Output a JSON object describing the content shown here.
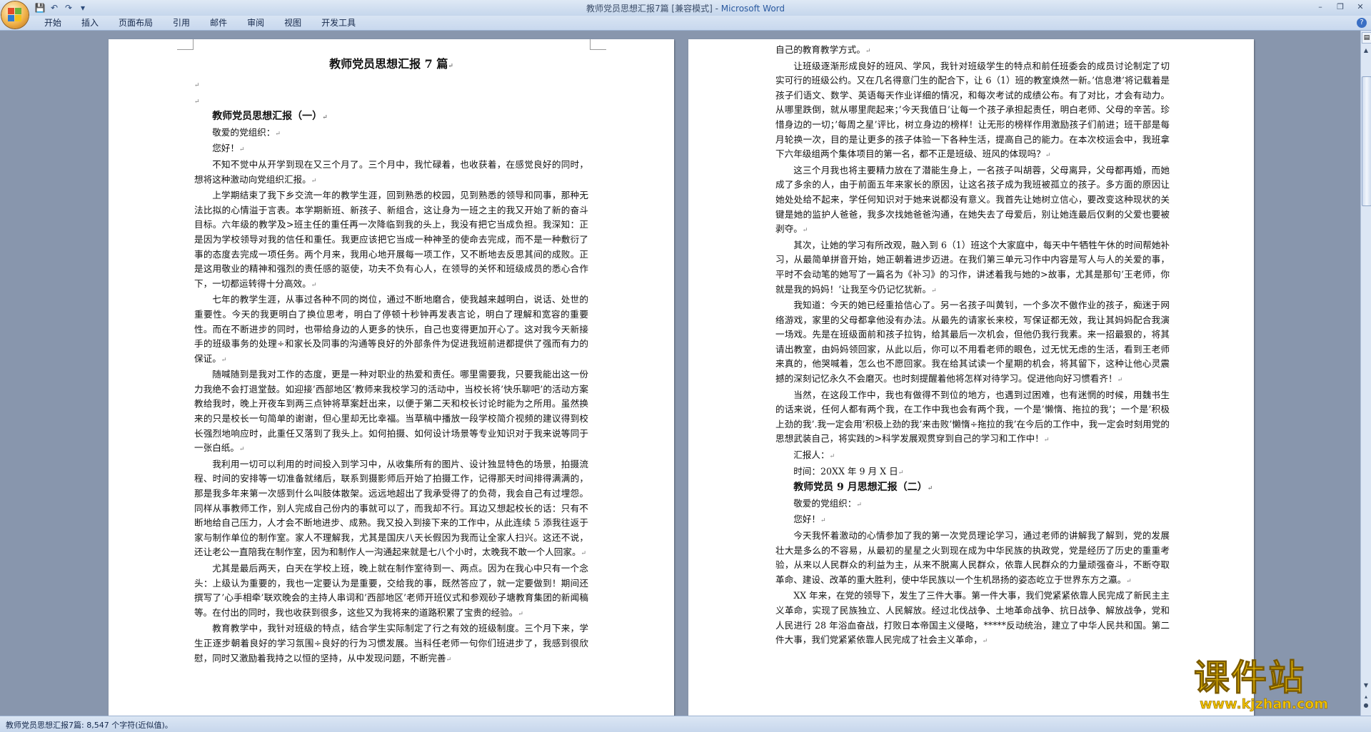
{
  "window": {
    "title": "教师党员思想汇报7篇 [兼容模式]",
    "app": "Microsoft Word"
  },
  "ribbon": {
    "tabs": [
      "开始",
      "插入",
      "页面布局",
      "引用",
      "邮件",
      "审阅",
      "视图",
      "开发工具"
    ]
  },
  "document": {
    "page1": [
      {
        "t": "doctitle",
        "x": "教师党员思想汇报 7 篇"
      },
      {
        "t": "ni",
        "x": ""
      },
      {
        "t": "ni",
        "x": ""
      },
      {
        "t": "h",
        "x": "教师党员思想汇报（一）"
      },
      {
        "t": "p",
        "x": "敬爱的党组织："
      },
      {
        "t": "p",
        "x": "您好！"
      },
      {
        "t": "p",
        "x": "不知不觉中从开学到现在又三个月了。三个月中，我忙碌着，也收获着，在感觉良好的同时，想将这种激动向党组织汇报。"
      },
      {
        "t": "p",
        "x": "上学期结束了我下乡交流一年的教学生涯，回到熟悉的校园，见到熟悉的领导和同事，那种无法比拟的心情溢于言表。本学期新班、新孩子、新组合，这让身为一班之主的我又开始了新的奋斗目标。六年级的教学及>班主任的重任再一次降临到我的头上，我没有把它当成负担。我深知：正是因为学校领导对我的信任和重任。我更应该把它当成一种神圣的使命去完成，而不是一种敷衍了事的态度去完成一项任务。两个月来，我用心地开展每一项工作，又不断地去反思其间的成败。正是这用敬业的精神和强烈的责任感的驱使，功夫不负有心人，在领导的关怀和班级成员的悉心合作下，一切都运转得十分高效。"
      },
      {
        "t": "p",
        "x": "七年的教学生涯，从事过各种不同的岗位，通过不断地磨合，使我越来越明白，说话、处世的重要性。今天的我更明白了换位思考，明白了停顿十秒钟再发表言论，明白了理解和宽容的重要性。而在不断进步的同时，也带给身边的人更多的快乐，自己也变得更加开心了。这对我今天新接手的班级事务的处理÷和家长及同事的沟通等良好的外部条件为促进我班前进都提供了强而有力的保证。"
      },
      {
        "t": "p",
        "x": "随喊随到是我对工作的态度，更是一种对职业的热爱和责任。哪里需要我，只要我能出这一份力我绝不会打退堂鼓。如迎接’西部地区’教师来我校学习的活动中，当校长将’快乐聊吧’的活动方案教给我时，晚上开夜车到两三点钟将草案赶出来，以便于第二天和校长讨论时能为之所用。虽然换来的只是校长一句简单的谢谢，但心里却无比幸福。当草稿中播放一段学校简介视频的建议得到校长强烈地响应时，此重任又落到了我头上。如何拍摄、如何设计场景等专业知识对于我来说等同于一张白纸。"
      },
      {
        "t": "p",
        "x": "我利用一切可以利用的时间投入到学习中，从收集所有的图片、设计独显特色的场景，拍摄流程、时间的安排等一切准备就绪后，联系到摄影师后开始了拍摄工作，记得那天时间排得满满的，那是我多年来第一次感到什么叫肢体散架。远远地超出了我承受得了的负荷，我会自己有过埋怨。同样从事教师工作，别人完成自己份内的事就可以了，而我却不行。耳边又想起校长的话：只有不断地给自己压力，人才会不断地进步、成熟。我又投入到接下来的工作中，从此连续 5 添我往返于家与制作单位的制作室。家人不理解我，尤其是国庆八天长假因为我而让全家人扫兴。这还不说，还让老公一直陪我在制作室，因为和制作人一沟通起来就是七八个小时，太晚我不敢一个人回家。"
      },
      {
        "t": "p",
        "x": "尤其是最后两天，白天在学校上班，晚上就在制作室待到一、两点。因为在我心中只有一个念头：上级认为重要的，我也一定要认为是重要，交给我的事，既然答应了，就一定要做到！期间还撰写了’心手相牵’联欢晚会的主持人串词和’西部地区’老师开班仪式和参观砂子塘教育集团的新闻稿等。在付出的同时，我也收获到很多，这些又为我将来的道路积累了宝贵的经验。"
      },
      {
        "t": "p",
        "x": "教育教学中，我针对班级的特点，结合学生实际制定了行之有效的班级制度。三个月下来，学生正逐步朝着良好的学习氛围÷良好的行为习惯发展。当科任老师一句你们班进步了，我感到很欣慰，同时又激励着我持之以恒的坚持，从中发现问题，不断完善"
      }
    ],
    "page2": [
      {
        "t": "ni",
        "x": "自己的教育教学方式。"
      },
      {
        "t": "p",
        "x": "让班级逐渐形成良好的班风、学风，我针对班级学生的特点和前任班委会的成员讨论制定了切实可行的班级公约。又在几名得意门生的配合下，让 6（1）班的教室焕然一新。’信息港’将记载着是孩子们语文、数学、英语每天作业详细的情况，和每次考试的成绩公布。有了对比，才会有动力。从哪里跌倒，就从哪里爬起来；’今天我值日’让每一个孩子承担起责任，明白老师、父母的辛苦。珍惜身边的一切；’每周之星’评比，树立身边的榜样！让无形的榜样作用激励孩子们前进；班干部是每月轮换一次，目的是让更多的孩子体验一下各种生活，提高自己的能力。在本次校运会中，我班拿下六年级组两个集体项目的第一名，都不正是班级、班风的体现吗？"
      },
      {
        "t": "p",
        "x": "这三个月我也将主要精力放在了潜能生身上，一名孩子叫胡蓉，父母离异，父母都再婚，而她成了多余的人，由于前面五年来家长的原因，让这名孩子成为我班被孤立的孩子。多方面的原因让她处处给不起来，学任何知识对于她来说都没有意义。我首先让她树立信心，要改变这种现状的关键是她的监护人爸爸，我多次找她爸爸沟通，在她失去了母爱后，别让她连最后仅剩的父爱也要被剥夺。"
      },
      {
        "t": "p",
        "x": "其次，让她的学习有所改观，融入到 6（1）班这个大家庭中，每天中午牺牲午休的时间帮她补习，从最简单拼音开始，她正朝着进步迈进。在我们第三单元习作中内容是写人与人的关爱的事，平时不会动笔的她写了一篇名为《补习》的习作，讲述着我与她的>故事，尤其是那句’王老师，你就是我的妈妈！’让我至今仍记忆犹新。"
      },
      {
        "t": "p",
        "x": "我知道：今天的她已经重拾信心了。另一名孩子叫黄钊，一个多次不傲作业的孩子，痴迷于网络游戏，家里的父母都拿他没有办法。从最先的请家长来校，写保证都无效，我让其妈妈配合我演一场戏。先是在班级面前和孩子拉钩，给其最后一次机会，但他仍我行我素。来一招最狠的，将其请出教室，由妈妈领回家，从此以后，你可以不用看老师的眼色，过无忧无虑的生活，看到王老师来真的，他哭喊着，怎么也不愿回家。我在给其试读一个星期的机会，将其留下，这种让他心灵震撼的深刻记忆永久不会磨灭。也时刻提醒着他将怎样对待学习。促进他向好习惯看齐！"
      },
      {
        "t": "p",
        "x": "当然，在这段工作中，我也有做得不到位的地方，也遇到过困难，也有迷惘的时候，用魏书生的话来说，任何人都有两个我，在工作中我也会有两个我，一个是’懒惰、拖拉的我’；一个是’积极上劲的我’.我一定会用’积极上劲的我’来击败’懒惰÷拖拉的我’在今后的工作中，我一定会时刻用党的思想武装自己，将实践的>科学发展观贯穿到自己的学习和工作中！"
      },
      {
        "t": "p",
        "x": "汇报人："
      },
      {
        "t": "p",
        "x": "时间：20XX 年 9 月 X 日"
      },
      {
        "t": "h",
        "x": "教师党员 9 月思想汇报（二）"
      },
      {
        "t": "p",
        "x": "敬爱的党组织："
      },
      {
        "t": "p",
        "x": "您好！"
      },
      {
        "t": "p",
        "x": "今天我怀着激动的心情参加了我的第一次党员理论学习，通过老师的讲解我了解到，党的发展壮大是多么的不容易，从最初的星星之火到现在成为中华民族的执政党，党是经历了历史的重重考验，从来以人民群众的利益为主，从来不脱离人民群众，依靠人民群众的力量顽强奋斗，不断夺取革命、建设、改革的重大胜利，使中华民族以一个生机昂扬的姿态屹立于世界东方之瀛。"
      },
      {
        "t": "p",
        "x": "XX 年来，在党的领导下，发生了三件大事。第一件大事，我们党紧紧依靠人民完成了新民主主义革命，实现了民族独立、人民解放。经过北伐战争、土地革命战争、抗日战争、解放战争，党和人民进行 28 年浴血奋战，打败日本帝国主义侵略，*****反动统治，建立了中华人民共和国。第二件大事，我们党紧紧依靠人民完成了社会主义革命，"
      }
    ]
  },
  "statusbar": {
    "text": "教师党员思想汇报7篇: 8,547 个字符(近似值)。"
  },
  "watermark": {
    "main": "课件站",
    "url": "www.kjzhan.com"
  },
  "colors": {
    "accent": "#2b5aa0",
    "workspace": "#8896ad",
    "watermark": "#f0c000"
  }
}
